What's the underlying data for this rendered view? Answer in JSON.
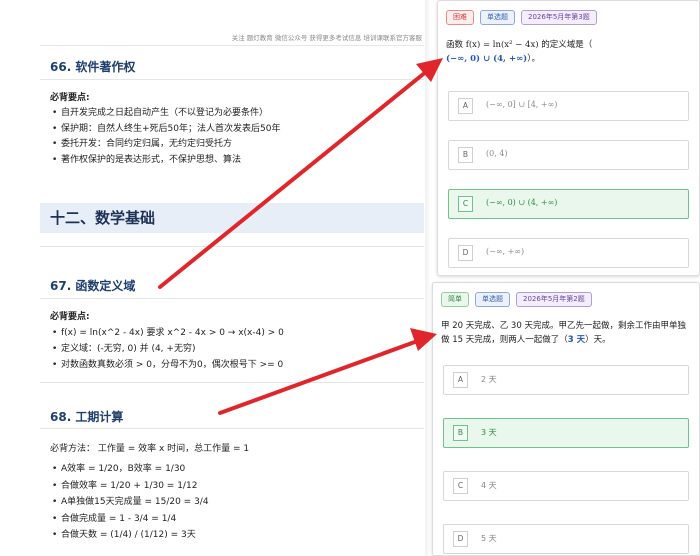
{
  "doc": {
    "header": "关注 题灯教育 微信公众号 获得更多考试信息 培训课联系官方客服",
    "sec66": {
      "title": "66. 软件著作权",
      "subtitle": "必背要点:",
      "items": [
        "自开发完成之日起自动产生（不以登记为必要条件）",
        "保护期：自然人终生+死后50年；法人首次发表后50年",
        "委托开发：合同约定归属，无约定归受托方",
        "著作权保护的是表达形式，不保护思想、算法"
      ]
    },
    "section12": "十二、数学基础",
    "sec67": {
      "title": "67. 函数定义域",
      "subtitle": "必背要点:",
      "items": [
        "f(x) = ln(x^2 - 4x) 要求 x^2 - 4x > 0 → x(x-4) > 0",
        "定义域：(-无穷, 0) 并 (4, +无穷)",
        "对数函数真数必须 > 0，分母不为0，偶次根号下 >= 0"
      ]
    },
    "sec68": {
      "title": "68. 工期计算",
      "subtitle": "必背方法：  工作量 = 效率 x 时间，总工作量 = 1",
      "items": [
        "A效率 = 1/20，B效率 = 1/30",
        "合做效率 = 1/20 + 1/30 = 1/12",
        "A单独做15天完成量 = 15/20 = 3/4",
        "合做完成量 = 1 - 3/4 = 1/4",
        "合做天数 = (1/4) / (1/12) = 3天"
      ]
    }
  },
  "card1": {
    "tags": {
      "difficulty": "困难",
      "type": "单选题",
      "source": "2026年5月年第3题"
    },
    "question_prefix": "函数 ",
    "question_formula": "f(x) = ln(x² − 4x)",
    "question_middle": " 的定义域是（",
    "question_answer": "(−∞, 0) ∪ (4, +∞)",
    "question_suffix": "）。",
    "options": [
      {
        "letter": "A",
        "text": "(−∞, 0] ∪ [4, +∞)"
      },
      {
        "letter": "B",
        "text": "(0, 4)"
      },
      {
        "letter": "C",
        "text": "(−∞, 0) ∪ (4, +∞)"
      },
      {
        "letter": "D",
        "text": "(−∞, +∞)"
      }
    ]
  },
  "card2": {
    "tags": {
      "difficulty": "简单",
      "type": "单选题",
      "source": "2026年5月年第2题"
    },
    "question_prefix": "甲 20 天完成、乙 30 天完成。甲乙先一起做，剩余工作由甲单独做 15 天完成，则两人一起做了（",
    "question_answer": "3 天",
    "question_suffix": "）天。",
    "options": [
      {
        "letter": "A",
        "text": "2 天"
      },
      {
        "letter": "B",
        "text": "3 天"
      },
      {
        "letter": "C",
        "text": "4 天"
      },
      {
        "letter": "D",
        "text": "5 天"
      }
    ]
  },
  "colors": {
    "arrow": "#e0262a",
    "correct_bg": "#e9f7ec",
    "correct_border": "#6fc289",
    "heading": "#1f3f6f",
    "answer_blue": "#2a55b5"
  },
  "icons": {
    "arrows": "red-pointer-arrow-icon"
  }
}
